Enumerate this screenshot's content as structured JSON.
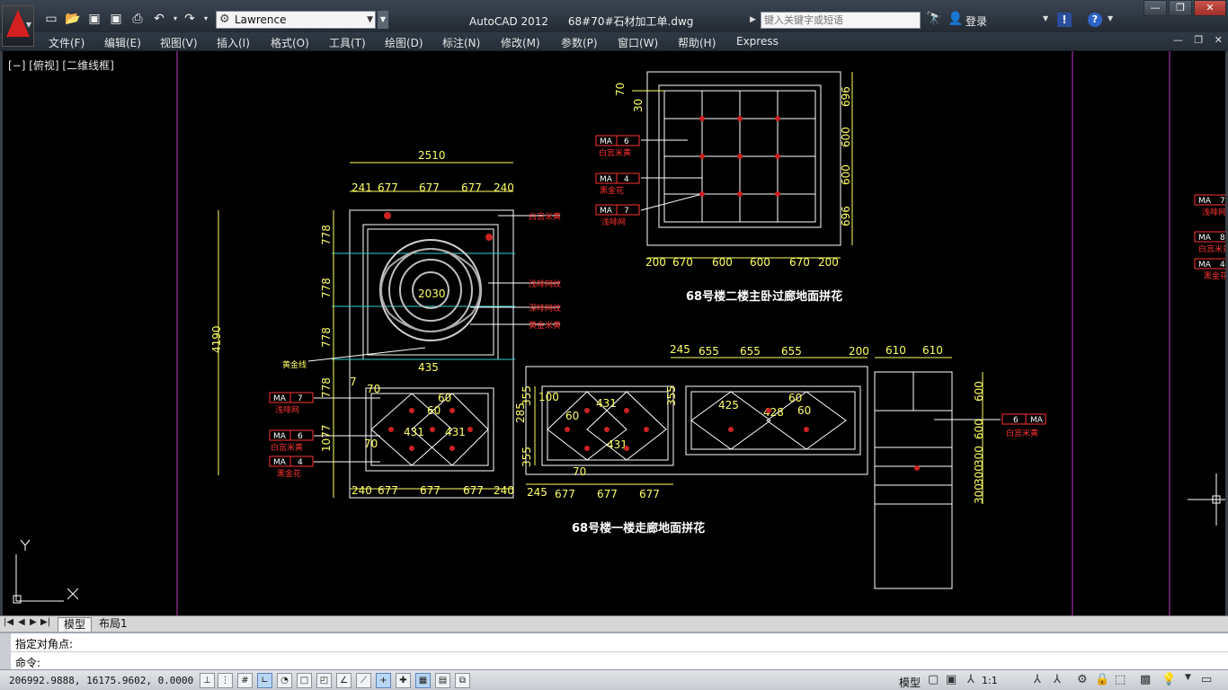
{
  "titlebar": {
    "workspace": "Lawrence",
    "app_name": "AutoCAD 2012",
    "file_name": "68#70#石材加工单.dwg",
    "search_placeholder": "键入关键字或短语",
    "login_label": "登录",
    "exchange_label": "!",
    "help_label": "?"
  },
  "menu": [
    "文件(F)",
    "编辑(E)",
    "视图(V)",
    "插入(I)",
    "格式(O)",
    "工具(T)",
    "绘图(D)",
    "标注(N)",
    "修改(M)",
    "参数(P)",
    "窗口(W)",
    "帮助(H)",
    "Express"
  ],
  "viewport_label": "[−] [俯视] [二维线框]",
  "ucs": {
    "x_label": "X",
    "y_label": "Y"
  },
  "drawing": {
    "plan_a": {
      "width_total": "2510",
      "top_dims": [
        "241",
        "677",
        "677",
        "677",
        "240"
      ],
      "bottom_dims": [
        "240",
        "677",
        "677",
        "677",
        "240"
      ],
      "left_total": "4190",
      "left_dims": [
        "778",
        "778",
        "778",
        "778",
        "1077"
      ],
      "center_dim": "2030",
      "mid_dim": "435",
      "small_dims": [
        "60",
        "60",
        "431",
        "431",
        "70",
        "70",
        "7"
      ],
      "labels": [
        "白宫米黄",
        "浅啡网纹",
        "深啡网纹",
        "黄金米黄",
        "黄金线"
      ],
      "tags": [
        {
          "code": "MA",
          "num": "7",
          "name": "浅啡网"
        },
        {
          "code": "MA",
          "num": "6",
          "name": "白宫米黄"
        },
        {
          "code": "MA",
          "num": "4",
          "name": "黑金花"
        }
      ]
    },
    "plan_b": {
      "top_dims": [
        "70",
        "30"
      ],
      "right_dims": [
        "696",
        "600",
        "600",
        "696"
      ],
      "bottom_dims": [
        "200",
        "670",
        "600",
        "600",
        "670",
        "200"
      ],
      "tags": [
        {
          "code": "MA",
          "num": "6",
          "name": "白宫米黄"
        },
        {
          "code": "MA",
          "num": "4",
          "name": "黑金花"
        },
        {
          "code": "MA",
          "num": "7",
          "name": "浅啡网"
        }
      ],
      "title": "68号楼二楼主卧过廊地面拼花"
    },
    "plan_c": {
      "top_dims": [
        "245",
        "655",
        "655",
        "655",
        "200"
      ],
      "bottom_dims": [
        "245",
        "677",
        "677",
        "677"
      ],
      "left_dims": [
        "100",
        "355",
        "285",
        "355"
      ],
      "side_dims": [
        "610",
        "610"
      ],
      "right_dims": [
        "600",
        "600",
        "300",
        "300",
        "300"
      ],
      "small_dims": [
        "60",
        "60",
        "431",
        "431",
        "60",
        "425",
        "428",
        "355",
        "70"
      ],
      "tag": {
        "code": "MA",
        "num": "6",
        "name": "白宫米黄"
      },
      "title": "68号楼一楼走廊地面拼花"
    },
    "edge_tags": [
      {
        "code": "MA",
        "num": "7",
        "name": "浅啡网"
      },
      {
        "code": "MA",
        "num": "8",
        "name": "白宫米黄"
      },
      {
        "code": "MA",
        "num": "4",
        "name": "黑金花"
      }
    ]
  },
  "tabs": {
    "model": "模型",
    "layout1": "布局1"
  },
  "command": {
    "history": "指定对角点:",
    "prompt": "命令:"
  },
  "status": {
    "coords": "206992.9888, 16175.9602, 0.0000",
    "model_label": "模型",
    "anno_scale": "1:1"
  },
  "colors": {
    "dim": "#ffff66",
    "geometry": "#ffffff",
    "tag": "#ff3333",
    "guide": "#cc33cc",
    "grid": "#33cccc"
  }
}
